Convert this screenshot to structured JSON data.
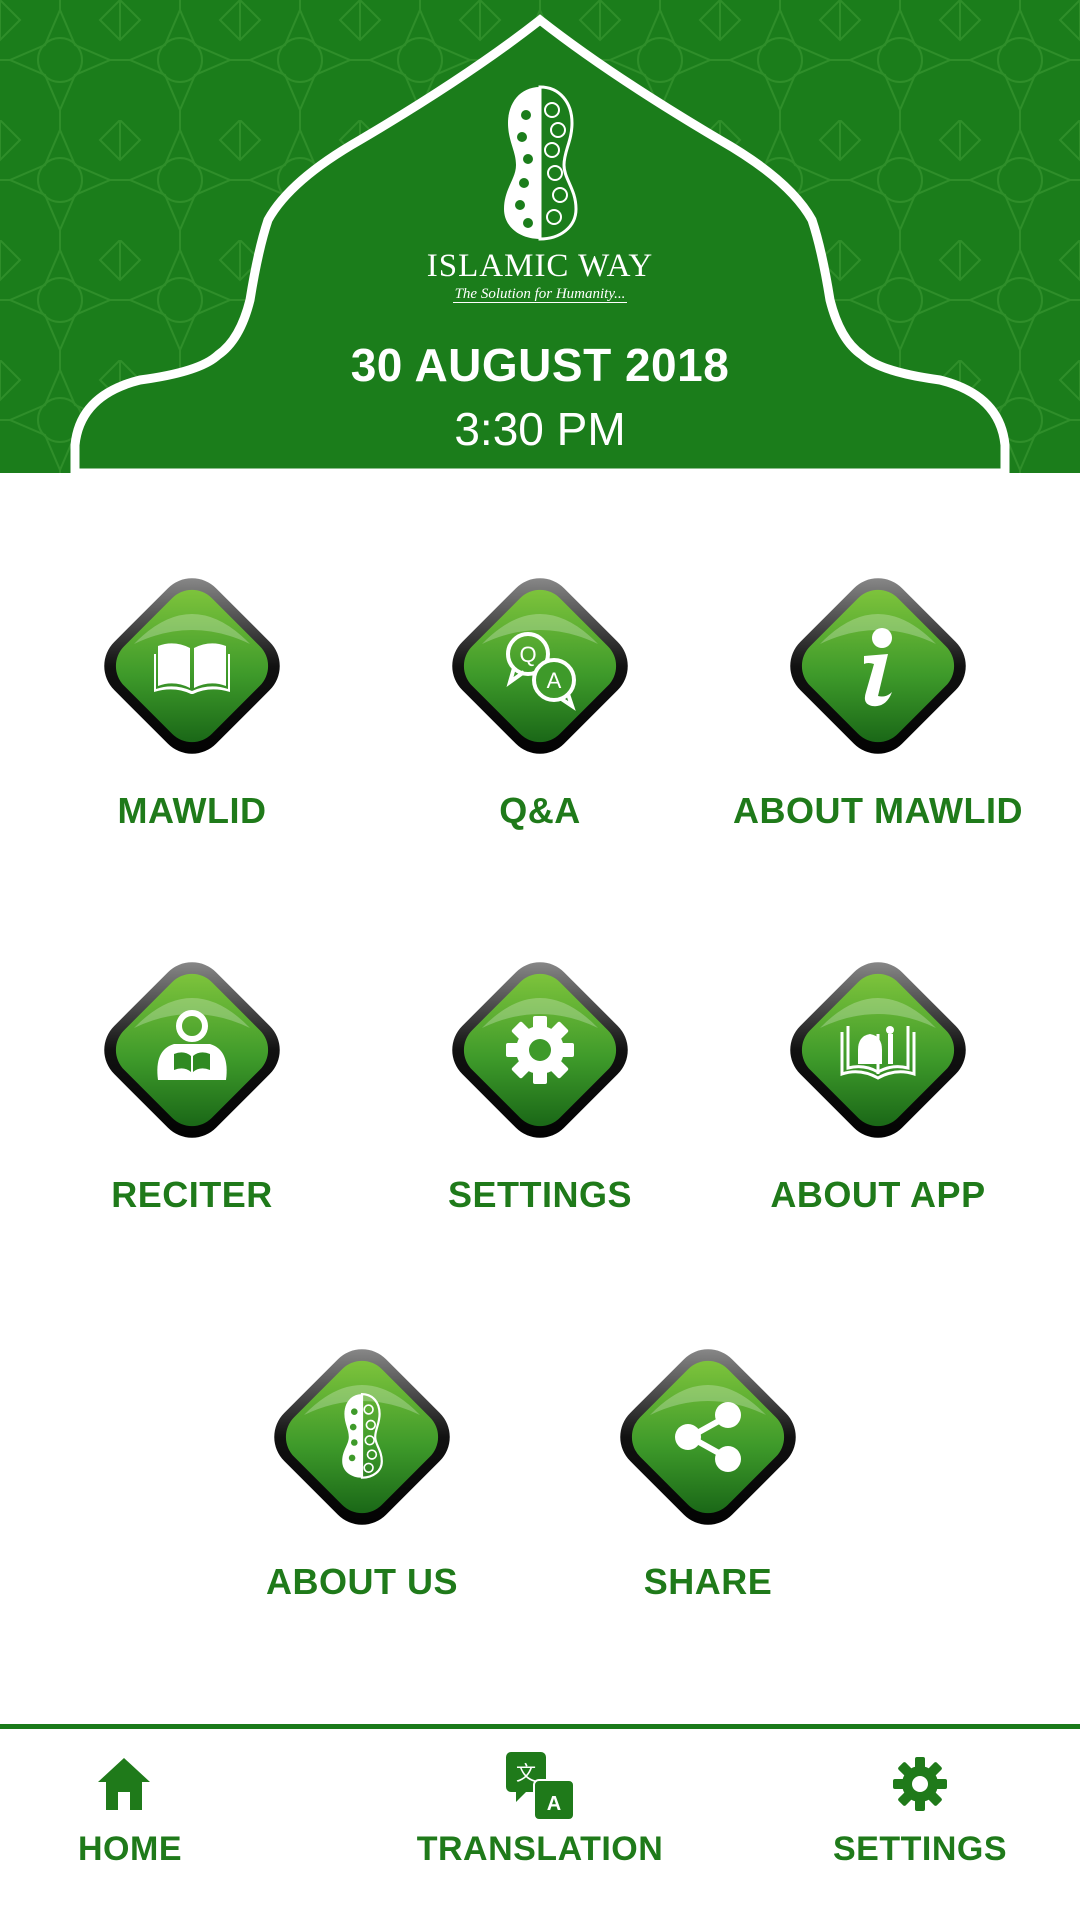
{
  "header": {
    "brand": "ISLAMIC WAY",
    "tagline": "The Solution for Humanity...",
    "date": "30 AUGUST 2018",
    "time": "3:30 PM"
  },
  "tiles": [
    {
      "label": "MAWLID",
      "icon": "book-icon"
    },
    {
      "label": "Q&A",
      "icon": "qa-bubbles-icon"
    },
    {
      "label": "ABOUT MAWLID",
      "icon": "info-icon"
    },
    {
      "label": "RECITER",
      "icon": "person-reading-icon"
    },
    {
      "label": "SETTINGS",
      "icon": "gear-icon"
    },
    {
      "label": "ABOUT APP",
      "icon": "quran-mosque-icon"
    },
    {
      "label": "ABOUT US",
      "icon": "sandal-logo-icon"
    },
    {
      "label": "SHARE",
      "icon": "share-icon"
    }
  ],
  "nav": {
    "home": "HOME",
    "translation": "TRANSLATION",
    "settings": "SETTINGS"
  },
  "colors": {
    "primary": "#1b7d1b",
    "label": "#1f7a1a",
    "gem_light": "#7cc23a",
    "gem_dark": "#1c6b17"
  }
}
